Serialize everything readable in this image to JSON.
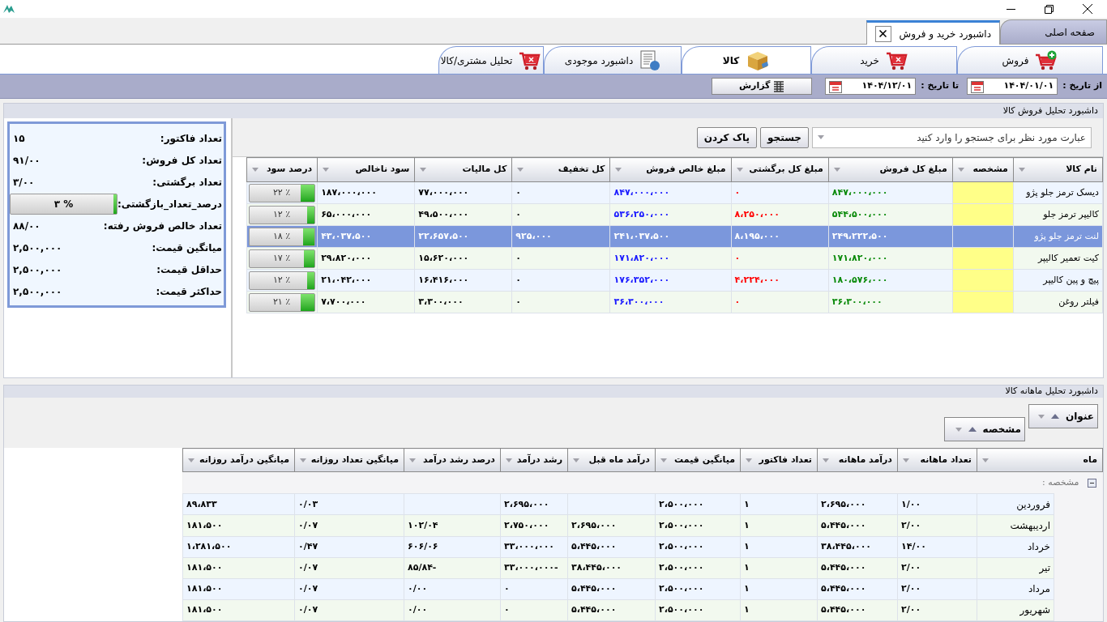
{
  "document_tabs": [
    {
      "label": "صفحه اصلی",
      "selected": false,
      "closable": false
    },
    {
      "label": "داشبورد خرید و فروش",
      "selected": true,
      "closable": true
    }
  ],
  "ribbon_tabs": [
    {
      "label": "فروش",
      "kind": "sale",
      "selected": false
    },
    {
      "label": "خرید",
      "kind": "purchase",
      "selected": false
    },
    {
      "label": "کالا",
      "kind": "product",
      "selected": true
    },
    {
      "label": "داشبورد موجودی",
      "kind": "stock",
      "selected": false
    },
    {
      "label": "تحلیل مشتری/کالا",
      "kind": "customer",
      "selected": false
    }
  ],
  "filter_bar": {
    "from_label": "از تاریخ :",
    "from_value": "۱۴۰۴/۰۱/۰۱",
    "to_label": "تا تاریخ :",
    "to_value": "۱۴۰۴/۱۲/۰۱",
    "report_button": "گزارش"
  },
  "sales_panel": {
    "title": "داشبورد تحلیل فروش کالا",
    "summary": [
      {
        "kind": "value",
        "label": "تعداد فاکتور:",
        "value": "۱۵"
      },
      {
        "kind": "value",
        "label": "تعداد کل فروش:",
        "value": "۹۱/۰۰"
      },
      {
        "kind": "value",
        "label": "تعداد برگشتی:",
        "value": "۳/۰۰"
      },
      {
        "kind": "meter",
        "label": "درصد_تعداد_بازگشتی:",
        "level": 0.03,
        "reading": "% ۳"
      },
      {
        "kind": "value",
        "label": "تعداد خالص فروش رفته:",
        "value": "۸۸/۰۰"
      },
      {
        "kind": "value",
        "label": "میانگین قیمت:",
        "value": "۲,۵۰۰,۰۰۰"
      },
      {
        "kind": "value",
        "label": "حداقل قیمت:",
        "value": "۲,۵۰۰,۰۰۰"
      },
      {
        "kind": "value",
        "label": "حداکثر قیمت:",
        "value": "۲,۵۰۰,۰۰۰"
      }
    ],
    "search": {
      "placeholder": "عبارت مورد نظر برای جستجو را وارد کنید",
      "buttons": [
        "جستجو",
        "پاک کردن"
      ]
    },
    "table": {
      "columns": [
        {
          "label": "نام کالا",
          "kind": "name"
        },
        {
          "label": "مشخصه",
          "kind": "tag"
        },
        {
          "label": "مبلغ کل فروش",
          "kind": "sales"
        },
        {
          "label": "مبلغ کل برگشتی",
          "kind": "returns"
        },
        {
          "label": "مبلغ خالص فروش",
          "kind": "net"
        },
        {
          "label": "کل تخفیف",
          "kind": "number"
        },
        {
          "label": "کل مالیات",
          "kind": "number"
        },
        {
          "label": "سود ناخالص",
          "kind": "number"
        },
        {
          "label": "درصد سود",
          "kind": "meter"
        }
      ],
      "rows": [
        {
          "selected": false,
          "cells": [
            "دیسک ترمز جلو پژو",
            null,
            "۸۴۷،۰۰۰،۰۰۰",
            "۰",
            "۸۴۷،۰۰۰،۰۰۰",
            "۰",
            "۷۷،۰۰۰،۰۰۰",
            "۱۸۷،۰۰۰،۰۰۰"
          ],
          "profit": {
            "level": 0.22,
            "reading": "٪ ۲۲"
          }
        },
        {
          "selected": false,
          "cells": [
            "کالیپر ترمز جلو",
            null,
            "۵۴۴،۵۰۰،۰۰۰",
            "۸،۲۵۰،۰۰۰",
            "۵۳۶،۲۵۰،۰۰۰",
            "۰",
            "۴۹،۵۰۰،۰۰۰",
            "۶۵،۰۰۰،۰۰۰"
          ],
          "profit": {
            "level": 0.12,
            "reading": "٪ ۱۲"
          }
        },
        {
          "selected": true,
          "cells": [
            "لنت ترمز جلو پژو",
            null,
            "۲۴۹،۲۲۲،۵۰۰",
            "۸،۱۹۵،۰۰۰",
            "۲۴۱،۰۳۷،۵۰۰",
            "۹۲۵،۰۰۰",
            "۲۲،۶۵۷،۵۰۰",
            "۴۳،۰۳۷،۵۰۰"
          ],
          "profit": {
            "level": 0.18,
            "reading": "٪ ۱۸"
          }
        },
        {
          "selected": false,
          "cells": [
            "کیت تعمیر کالیپر",
            null,
            "۱۷۱،۸۲۰،۰۰۰",
            "۰",
            "۱۷۱،۸۲۰،۰۰۰",
            "۰",
            "۱۵،۶۲۰،۰۰۰",
            "۲۹،۸۲۰،۰۰۰"
          ],
          "profit": {
            "level": 0.17,
            "reading": "٪ ۱۷"
          }
        },
        {
          "selected": false,
          "cells": [
            "پیچ و پین کالیپر",
            null,
            "۱۸۰،۵۷۶،۰۰۰",
            "۴،۲۲۴،۰۰۰",
            "۱۷۶،۳۵۲،۰۰۰",
            "۰",
            "۱۶،۴۱۶،۰۰۰",
            "۲۱،۰۴۲،۰۰۰"
          ],
          "profit": {
            "level": 0.12,
            "reading": "٪ ۱۲"
          }
        },
        {
          "selected": false,
          "cells": [
            "فیلتر روغن",
            null,
            "۳۶،۳۰۰،۰۰۰",
            "۰",
            "۳۶،۳۰۰،۰۰۰",
            "۰",
            "۳،۳۰۰،۰۰۰",
            "۷،۷۰۰،۰۰۰"
          ],
          "profit": {
            "level": 0.21,
            "reading": "٪ ۲۱"
          }
        }
      ]
    }
  },
  "monthly_panel": {
    "title": "داشبورد تحلیل ماهانه کالا",
    "group_fields": [
      "عنوان",
      "مشخصه"
    ],
    "table": {
      "columns": [
        "ماه",
        "تعداد ماهانه",
        "درآمد ماهانه",
        "تعداد فاکتور",
        "میانگین قیمت",
        "درآمد ماه قبل",
        "رشد درآمد",
        "درصد رشد درآمد",
        "میانگین تعداد روزانه",
        "میانگین درآمد روزانه"
      ],
      "group_label": "مشخصه :",
      "group_expanded": true,
      "rows": [
        [
          "فروردین",
          "۱/۰۰",
          "۲،۶۹۵،۰۰۰",
          "۱",
          "۲،۵۰۰،۰۰۰",
          null,
          "۲،۶۹۵،۰۰۰",
          null,
          "۰/۰۳",
          "۸۹،۸۳۳"
        ],
        [
          "اردیبهشت",
          "۲/۰۰",
          "۵،۴۴۵،۰۰۰",
          "۱",
          "۲،۵۰۰،۰۰۰",
          "۲،۶۹۵،۰۰۰",
          "۲،۷۵۰،۰۰۰",
          "۱۰۲/۰۴",
          "۰/۰۷",
          "۱۸۱،۵۰۰"
        ],
        [
          "خرداد",
          "۱۴/۰۰",
          "۳۸،۴۴۵،۰۰۰",
          "۱",
          "۲،۵۰۰،۰۰۰",
          "۵،۴۴۵،۰۰۰",
          "۳۳،۰۰۰،۰۰۰",
          "۶۰۶/۰۶",
          "۰/۴۷",
          "۱،۲۸۱،۵۰۰"
        ],
        [
          "تیر",
          "۲/۰۰",
          "۵،۴۴۵،۰۰۰",
          "۱",
          "۲،۵۰۰،۰۰۰",
          "۳۸،۴۴۵،۰۰۰",
          "۳۳،۰۰۰،۰۰۰-",
          "۸۵/۸۴-",
          "۰/۰۷",
          "۱۸۱،۵۰۰"
        ],
        [
          "مرداد",
          "۲/۰۰",
          "۵،۴۴۵،۰۰۰",
          "۱",
          "۲،۵۰۰،۰۰۰",
          "۵،۴۴۵،۰۰۰",
          "۰",
          "۰/۰۰",
          "۰/۰۷",
          "۱۸۱،۵۰۰"
        ],
        [
          "شهریور",
          "۲/۰۰",
          "۵،۴۴۵،۰۰۰",
          "۱",
          "۲،۵۰۰،۰۰۰",
          "۵،۴۴۵،۰۰۰",
          "۰",
          "۰/۰۰",
          "۰/۰۷",
          "۱۸۱،۵۰۰"
        ]
      ]
    }
  }
}
